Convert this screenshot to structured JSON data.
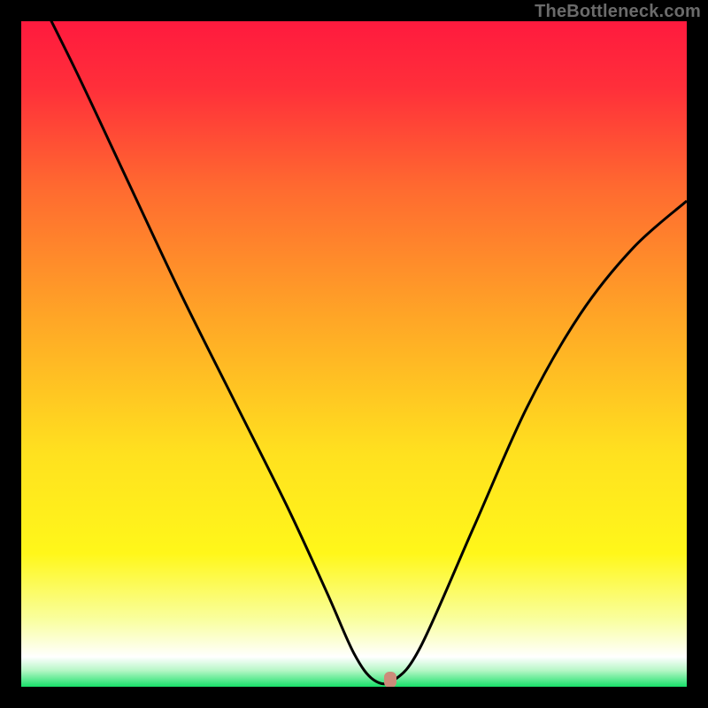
{
  "attribution": "TheBottleneck.com",
  "chart_data": {
    "type": "line",
    "title": "",
    "xlabel": "",
    "ylabel": "",
    "xlim": [
      0,
      1
    ],
    "ylim": [
      0,
      1
    ],
    "x": [
      0.0,
      0.08,
      0.16,
      0.24,
      0.32,
      0.4,
      0.46,
      0.5,
      0.53,
      0.56,
      0.6,
      0.68,
      0.76,
      0.84,
      0.92,
      1.0
    ],
    "values": [
      1.09,
      0.93,
      0.76,
      0.59,
      0.43,
      0.27,
      0.14,
      0.05,
      0.01,
      0.01,
      0.06,
      0.24,
      0.42,
      0.56,
      0.66,
      0.73
    ],
    "marker": {
      "x": 0.555,
      "y": 0.01
    },
    "marker_color": "#cc8b7a",
    "gradient_stops": [
      {
        "offset": 0.0,
        "color": "#ff1a3e"
      },
      {
        "offset": 0.1,
        "color": "#ff2f3a"
      },
      {
        "offset": 0.25,
        "color": "#ff6a30"
      },
      {
        "offset": 0.45,
        "color": "#ffa726"
      },
      {
        "offset": 0.65,
        "color": "#ffe11f"
      },
      {
        "offset": 0.8,
        "color": "#fff71a"
      },
      {
        "offset": 0.9,
        "color": "#f9ffa0"
      },
      {
        "offset": 0.955,
        "color": "#ffffff"
      },
      {
        "offset": 0.975,
        "color": "#b8f7c8"
      },
      {
        "offset": 1.0,
        "color": "#18e06a"
      }
    ]
  }
}
